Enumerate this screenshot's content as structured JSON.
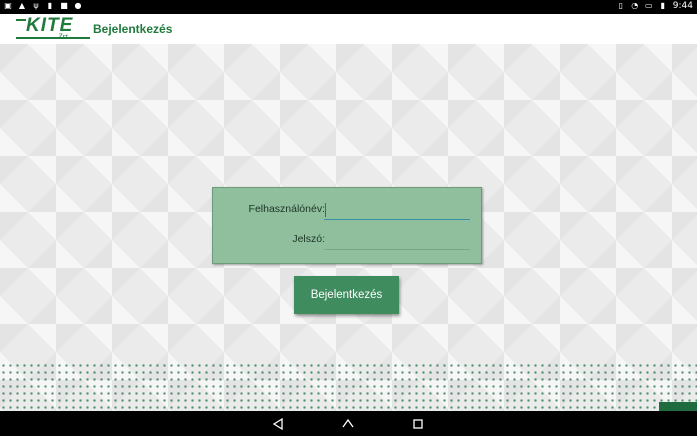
{
  "status_bar": {
    "time": "9:44",
    "left_icons": [
      "image-icon",
      "warning-icon",
      "usb-icon",
      "sd-card-icon",
      "lock-icon",
      "location-icon"
    ],
    "right_icons": [
      "vibrate-icon",
      "wifi-icon",
      "screen-off-icon",
      "battery-icon"
    ]
  },
  "app_bar": {
    "logo_text": "KITE",
    "logo_subtext": "Zrt.",
    "title": "Bejelentkezés"
  },
  "login_form": {
    "username_label": "Felhasználónév:",
    "username_value": "",
    "password_label": "Jelszó:",
    "password_value": "",
    "submit_label": "Bejelentkezés"
  },
  "nav_bar": {
    "items": [
      "back-icon",
      "home-icon",
      "recents-icon"
    ]
  },
  "colors": {
    "brand_green": "#1f7a3c",
    "card_green": "#8fbf9d",
    "button_green": "#3f8c5e"
  }
}
